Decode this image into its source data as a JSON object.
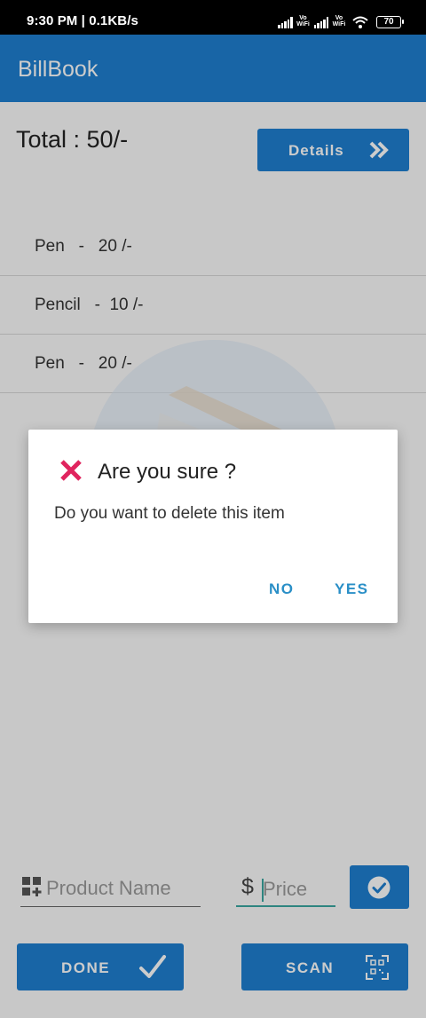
{
  "status_bar": {
    "time": "9:30 PM | 0.1KB/s",
    "vowifi_1": "Vo WiFi",
    "vowifi_2": "Vo WiFi",
    "battery": "70"
  },
  "app_bar": {
    "title": "BillBook"
  },
  "summary": {
    "total": "Total : 50/-",
    "details_label": "Details"
  },
  "items": [
    {
      "text": "Pen   -   20 /-"
    },
    {
      "text": "Pencil   -  10 /-"
    },
    {
      "text": "Pen   -   20 /-"
    }
  ],
  "form": {
    "product_placeholder": "Product Name",
    "price_symbol": "$",
    "price_placeholder": "Price",
    "done_label": "DONE",
    "scan_label": "SCAN"
  },
  "dialog": {
    "title": "Are you sure ?",
    "message": "Do you want to delete this item",
    "no_label": "NO",
    "yes_label": "YES"
  },
  "colors": {
    "primary": "#1e7fd0",
    "accent_teal": "#3aa7a0",
    "dialog_button": "#2a8fc7",
    "error_icon": "#e0245e"
  },
  "icons": {
    "details": "double-chevron-right-icon",
    "product": "widgets-add-icon",
    "check": "check-circle-icon",
    "done": "checkmark-icon",
    "scan": "qr-scan-icon",
    "dialog": "close-x-icon"
  }
}
